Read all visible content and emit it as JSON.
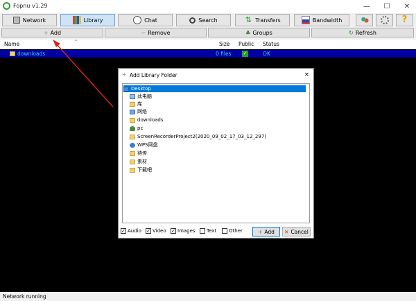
{
  "window": {
    "title": "Fopnu v1.29",
    "minimize": "—",
    "maximize": "☐",
    "close": "✕"
  },
  "toolbar": {
    "network": "Network",
    "library": "Library",
    "chat": "Chat",
    "search": "Search",
    "transfers": "Transfers",
    "bandwidth": "Bandwidth"
  },
  "actions": {
    "add": "Add",
    "remove": "Remove",
    "groups": "Groups",
    "refresh": "Refresh"
  },
  "list": {
    "columns": {
      "name": "Name",
      "size": "Size",
      "public": "Public",
      "status": "Status"
    },
    "rows": [
      {
        "name": "downloads",
        "size": "0 files",
        "public": "✓",
        "status": "OK"
      }
    ]
  },
  "status": {
    "text": "Network running"
  },
  "dialog": {
    "title": "Add Library Folder",
    "close": "✕",
    "tree": [
      "Desktop",
      "此电脑",
      "库",
      "网络",
      "downloads",
      "pc",
      "ScreenRecorderProject2(2020_09_02_17_03_12_297)",
      "WPS网盘",
      "待传",
      "素材",
      "下载吧"
    ],
    "filters": {
      "audio": "Audio",
      "video": "Video",
      "images": "Images",
      "text": "Text",
      "other": "Other"
    },
    "add_button": "Add",
    "cancel_button": "Cancel"
  },
  "colors": {
    "accent": "#0078d7",
    "annotation_arrow": "#d9201e",
    "row_bg": "#0000a0",
    "row_text": "#3ad1e6"
  }
}
